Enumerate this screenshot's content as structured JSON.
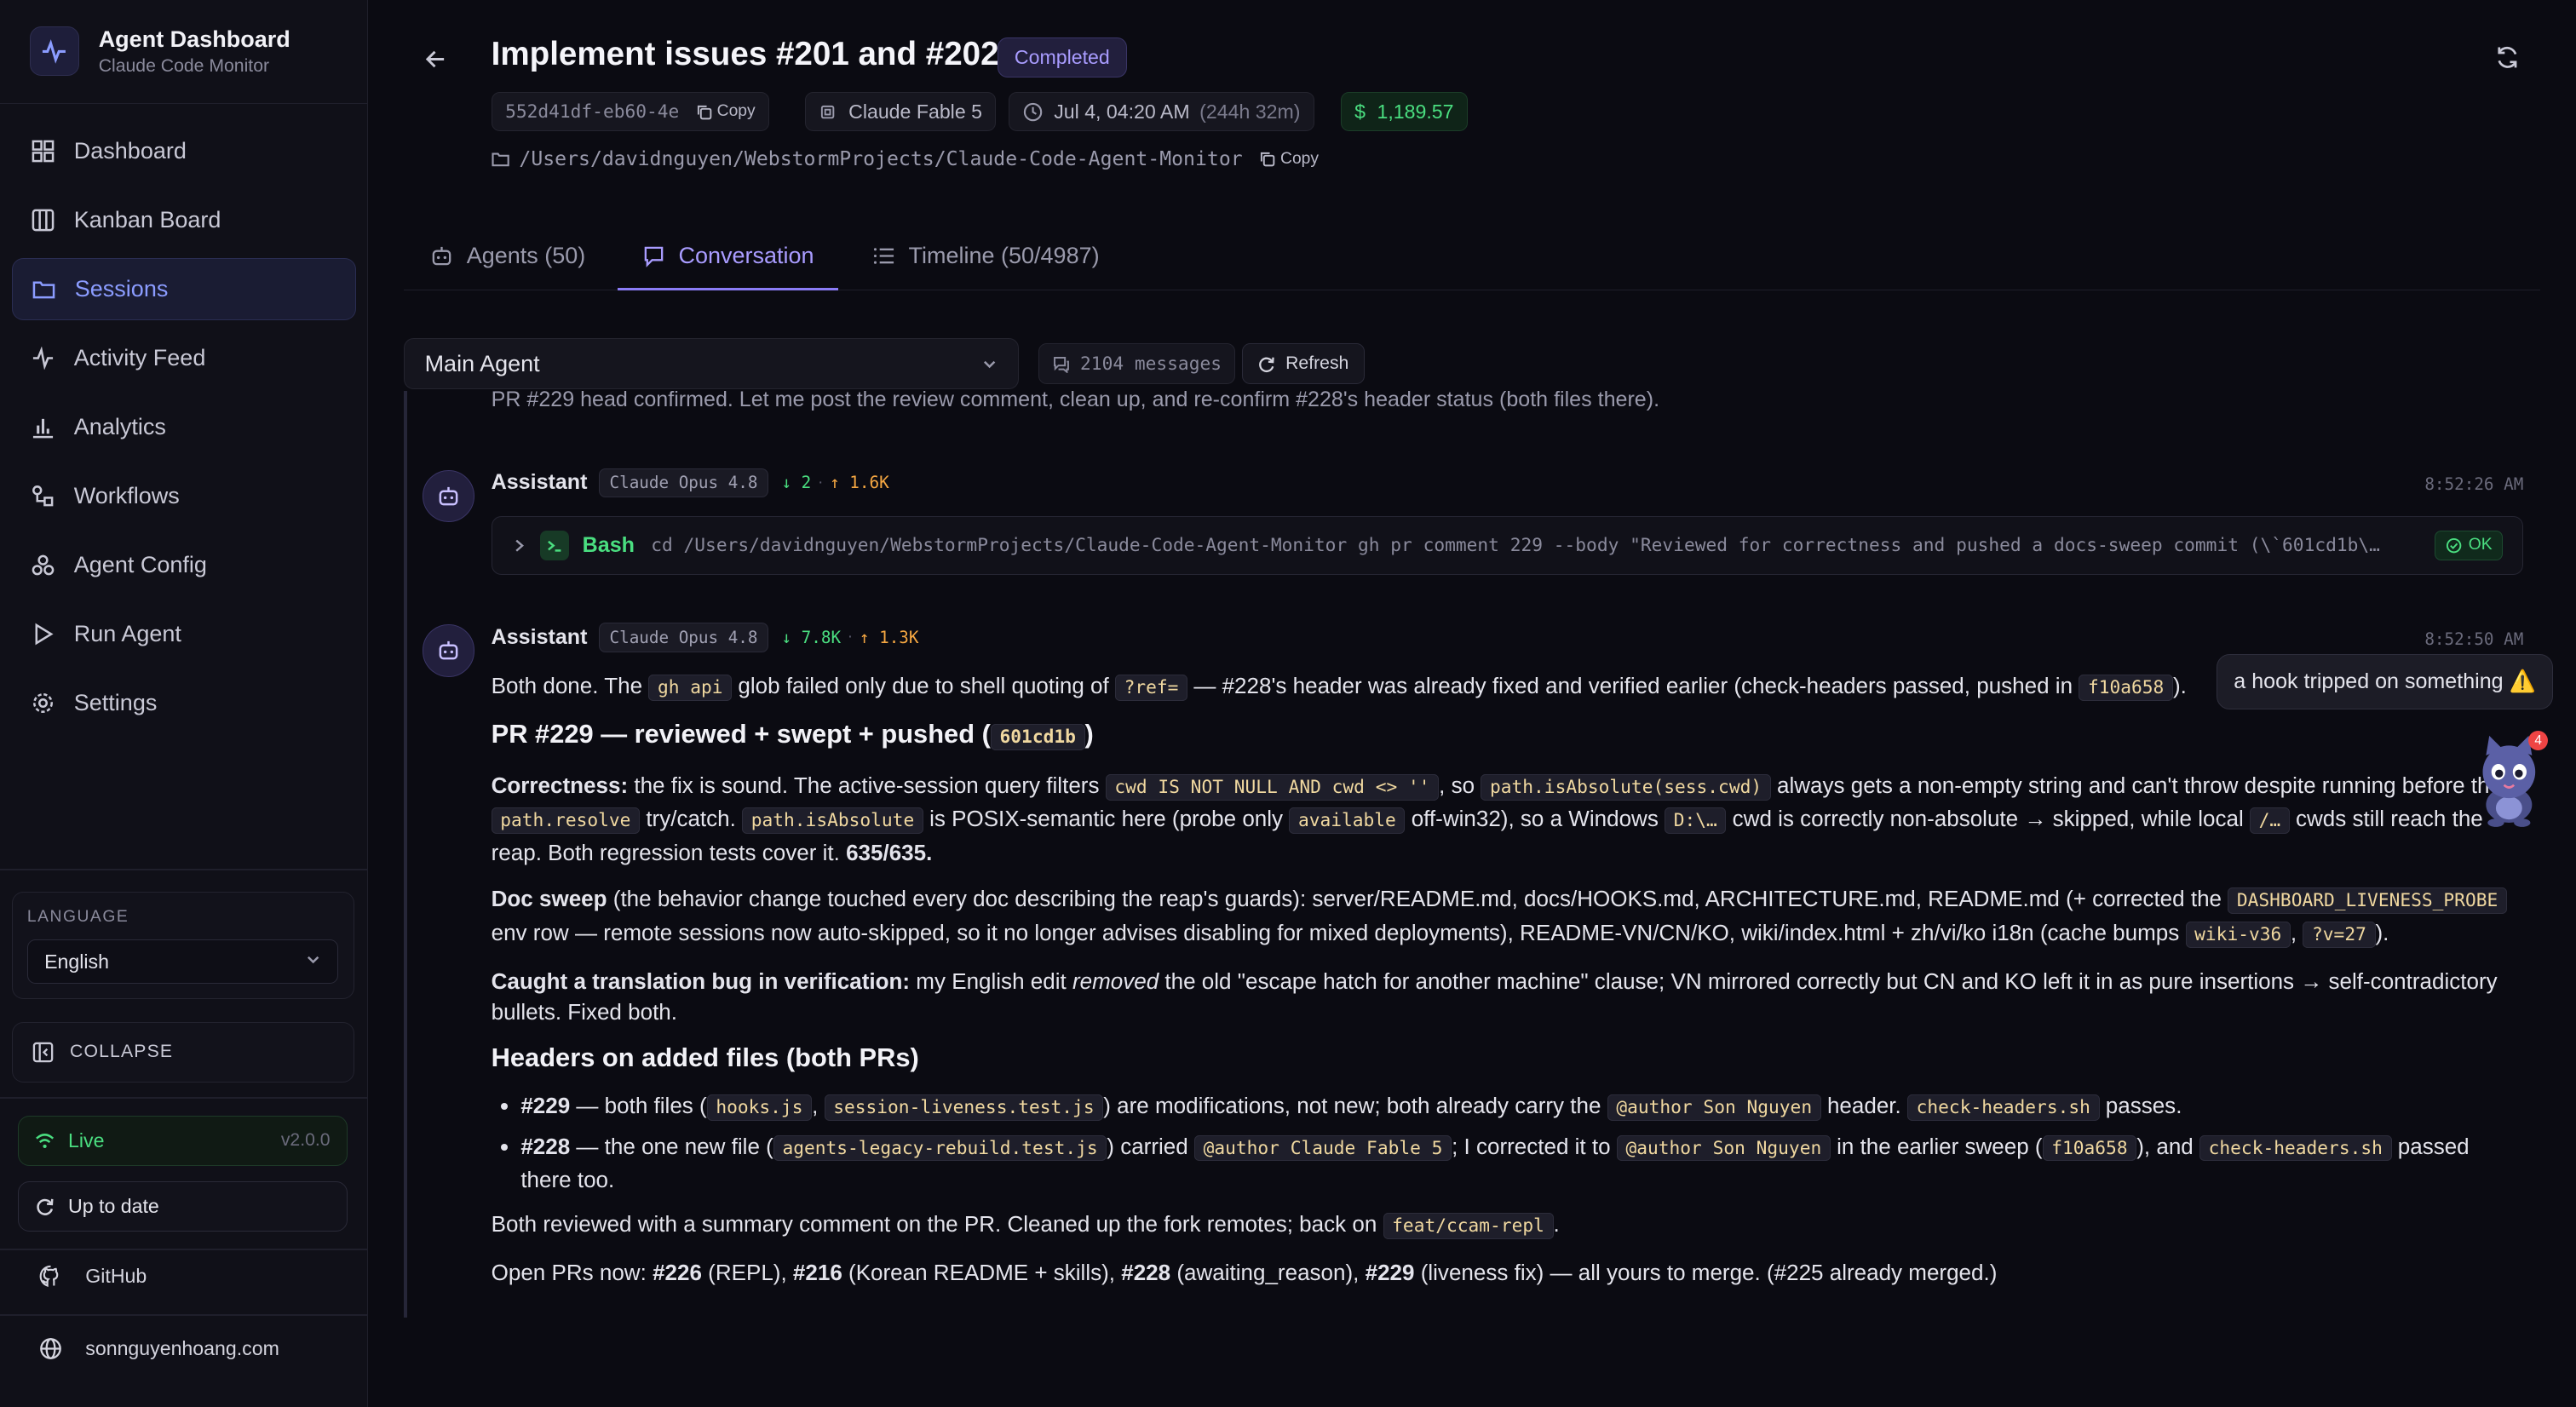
{
  "brand": {
    "title": "Agent Dashboard",
    "subtitle": "Claude Code Monitor"
  },
  "sidebar": {
    "items": [
      {
        "label": "Dashboard",
        "icon": "grid-icon"
      },
      {
        "label": "Kanban Board",
        "icon": "columns-icon"
      },
      {
        "label": "Sessions",
        "icon": "folder-icon",
        "active": true
      },
      {
        "label": "Activity Feed",
        "icon": "activity-icon"
      },
      {
        "label": "Analytics",
        "icon": "bar-chart-icon"
      },
      {
        "label": "Workflows",
        "icon": "workflow-icon"
      },
      {
        "label": "Agent Config",
        "icon": "config-icon"
      },
      {
        "label": "Run Agent",
        "icon": "play-icon"
      },
      {
        "label": "Settings",
        "icon": "gear-icon"
      }
    ],
    "language_label": "LANGUAGE",
    "language_value": "English",
    "collapse_label": "COLLAPSE",
    "live_label": "Live",
    "version": "v2.0.0",
    "update_label": "Up to date",
    "github_label": "GitHub",
    "website_label": "sonnguyenhoang.com"
  },
  "header": {
    "title": "Implement issues #201 and #202",
    "status": "Completed",
    "session_id": "552d41df-eb60-4e",
    "copy_label": "Copy",
    "model": "Claude Fable 5",
    "date": "Jul 4, 04:20 AM",
    "duration": "(244h 32m)",
    "cost": "1,189.57",
    "path": "/Users/davidnguyen/WebstormProjects/Claude-Code-Agent-Monitor",
    "path_copy_label": "Copy"
  },
  "tabs": [
    {
      "label": "Agents (50)"
    },
    {
      "label": "Conversation",
      "active": true
    },
    {
      "label": "Timeline (50/4987)"
    }
  ],
  "toolbar": {
    "agent_select": "Main Agent",
    "message_count": "2104 messages",
    "refresh_label": "Refresh"
  },
  "conversation": {
    "cut_off_text": "PR #229 head confirmed. Let me post the review comment, clean up, and re-confirm #228's header status (both files there).",
    "msg1": {
      "role": "Assistant",
      "model": "Claude Opus 4.8",
      "tokens_in": "↓ 2",
      "tokens_out": "↑ 1.6K",
      "time": "8:52:26 AM",
      "tool_name": "Bash",
      "tool_cmd": "cd /Users/davidnguyen/WebstormProjects/Claude-Code-Agent-Monitor gh pr comment 229 --body \"Reviewed for correctness and pushed a docs-sweep commit (\\`601cd1b\\…",
      "tool_status": "OK"
    },
    "msg2": {
      "role": "Assistant",
      "model": "Claude Opus 4.8",
      "tokens_in": "↓ 7.8K",
      "tokens_out": "↑ 1.3K",
      "time": "8:52:50 AM"
    }
  },
  "toast": {
    "text": "a hook tripped on something ⚠️"
  },
  "mascot": {
    "badge": "4"
  },
  "colors": {
    "accent": "#8b7cf6",
    "success": "#4ade80",
    "warning": "#f5a742"
  }
}
